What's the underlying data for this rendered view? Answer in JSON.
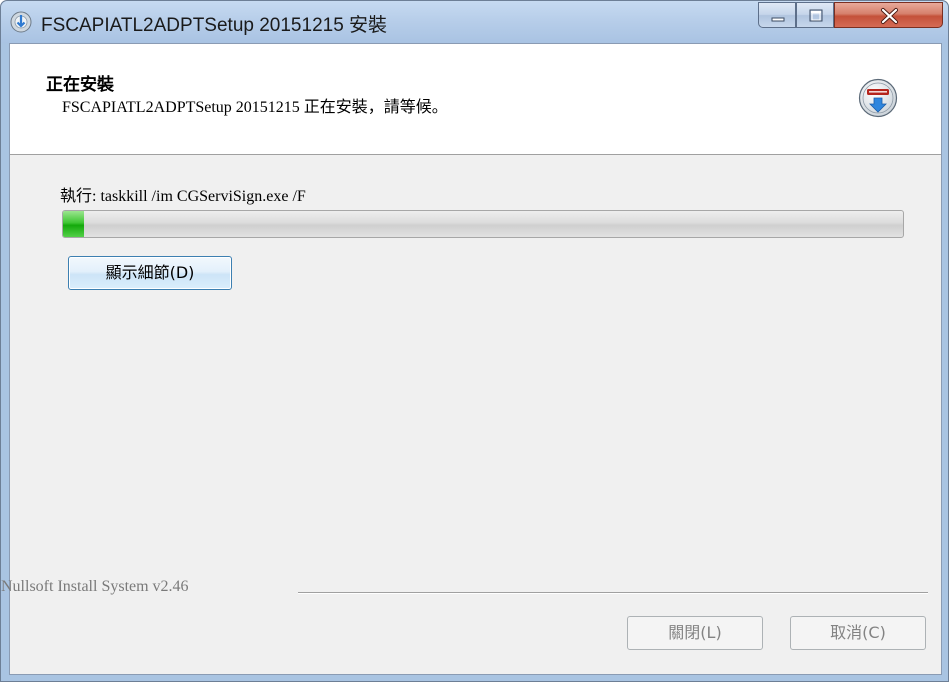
{
  "window": {
    "title": "FSCAPIATL2ADPTSetup 20151215 安裝",
    "icon": "installer-disc-icon"
  },
  "caption_buttons": {
    "minimize_icon": "minimize-icon",
    "maximize_icon": "maximize-icon",
    "close_icon": "close-icon"
  },
  "header": {
    "title": "正在安裝",
    "subtitle": "FSCAPIATL2ADPTSetup 20151215 正在安裝，請等候。",
    "logo": "nsis-logo-icon"
  },
  "main": {
    "status": "執行: taskkill /im CGServiSign.exe /F",
    "progress_fraction": 0.025,
    "details_button_label": "顯示細節(D)"
  },
  "footer": {
    "branding": "Nullsoft Install System v2.46",
    "close_label": "關閉(L)",
    "cancel_label": "取消(C)"
  },
  "colors": {
    "progress_fill": "#14a90c",
    "titlebar": "#b6cde9",
    "close_caption": "#c4513a"
  }
}
